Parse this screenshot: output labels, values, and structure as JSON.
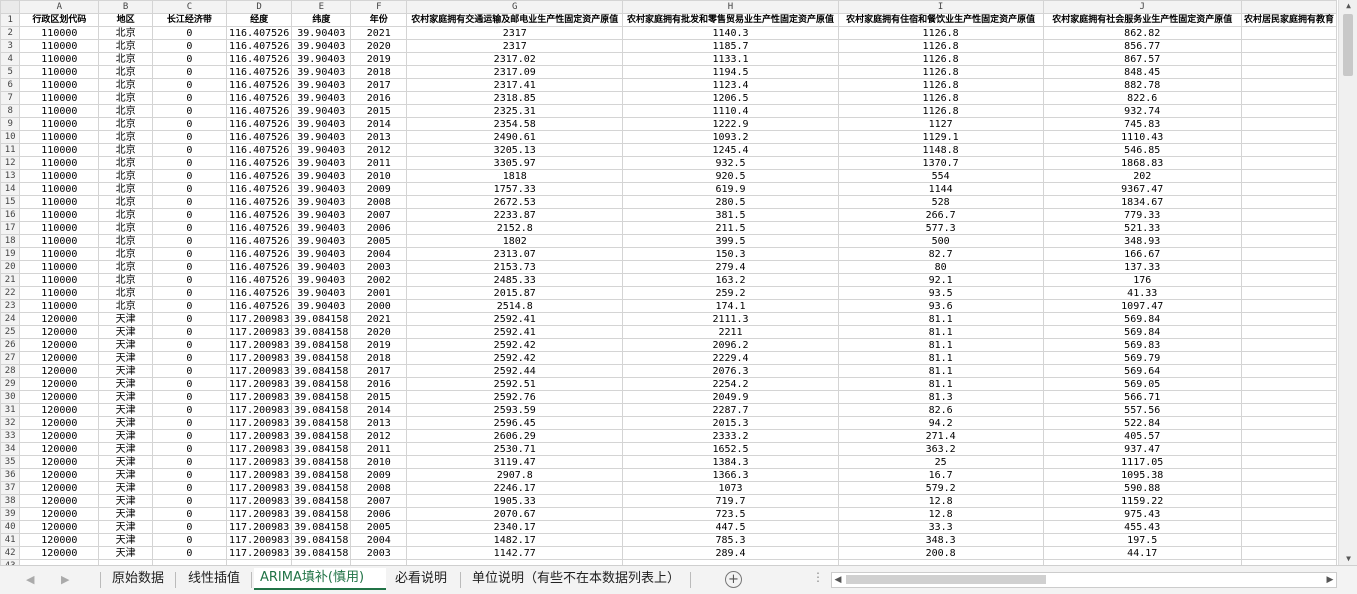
{
  "columns": [
    "A",
    "B",
    "C",
    "D",
    "E",
    "F",
    "G",
    "H",
    "I",
    "J"
  ],
  "headers": [
    "行政区划代码",
    "地区",
    "长江经济带",
    "经度",
    "纬度",
    "年份",
    "农村家庭拥有交通运输及邮电业生产性固定资产原值",
    "农村家庭拥有批发和零售贸易业生产性固定资产原值",
    "农村家庭拥有住宿和餐饮业生产性固定资产原值",
    "农村家庭拥有社会服务业生产性固定资产原值",
    "农村居民家庭拥有教育"
  ],
  "rows": [
    [
      "110000",
      "北京",
      "0",
      "116.407526",
      "39.90403",
      "2021",
      "2317",
      "1140.3",
      "1126.8",
      "862.82"
    ],
    [
      "110000",
      "北京",
      "0",
      "116.407526",
      "39.90403",
      "2020",
      "2317",
      "1185.7",
      "1126.8",
      "856.77"
    ],
    [
      "110000",
      "北京",
      "0",
      "116.407526",
      "39.90403",
      "2019",
      "2317.02",
      "1133.1",
      "1126.8",
      "867.57"
    ],
    [
      "110000",
      "北京",
      "0",
      "116.407526",
      "39.90403",
      "2018",
      "2317.09",
      "1194.5",
      "1126.8",
      "848.45"
    ],
    [
      "110000",
      "北京",
      "0",
      "116.407526",
      "39.90403",
      "2017",
      "2317.41",
      "1123.4",
      "1126.8",
      "882.78"
    ],
    [
      "110000",
      "北京",
      "0",
      "116.407526",
      "39.90403",
      "2016",
      "2318.85",
      "1206.5",
      "1126.8",
      "822.6"
    ],
    [
      "110000",
      "北京",
      "0",
      "116.407526",
      "39.90403",
      "2015",
      "2325.31",
      "1110.4",
      "1126.8",
      "932.74"
    ],
    [
      "110000",
      "北京",
      "0",
      "116.407526",
      "39.90403",
      "2014",
      "2354.58",
      "1222.9",
      "1127",
      "745.83"
    ],
    [
      "110000",
      "北京",
      "0",
      "116.407526",
      "39.90403",
      "2013",
      "2490.61",
      "1093.2",
      "1129.1",
      "1110.43"
    ],
    [
      "110000",
      "北京",
      "0",
      "116.407526",
      "39.90403",
      "2012",
      "3205.13",
      "1245.4",
      "1148.8",
      "546.85"
    ],
    [
      "110000",
      "北京",
      "0",
      "116.407526",
      "39.90403",
      "2011",
      "3305.97",
      "932.5",
      "1370.7",
      "1868.83"
    ],
    [
      "110000",
      "北京",
      "0",
      "116.407526",
      "39.90403",
      "2010",
      "1818",
      "920.5",
      "554",
      "202"
    ],
    [
      "110000",
      "北京",
      "0",
      "116.407526",
      "39.90403",
      "2009",
      "1757.33",
      "619.9",
      "1144",
      "9367.47"
    ],
    [
      "110000",
      "北京",
      "0",
      "116.407526",
      "39.90403",
      "2008",
      "2672.53",
      "280.5",
      "528",
      "1834.67"
    ],
    [
      "110000",
      "北京",
      "0",
      "116.407526",
      "39.90403",
      "2007",
      "2233.87",
      "381.5",
      "266.7",
      "779.33"
    ],
    [
      "110000",
      "北京",
      "0",
      "116.407526",
      "39.90403",
      "2006",
      "2152.8",
      "211.5",
      "577.3",
      "521.33"
    ],
    [
      "110000",
      "北京",
      "0",
      "116.407526",
      "39.90403",
      "2005",
      "1802",
      "399.5",
      "500",
      "348.93"
    ],
    [
      "110000",
      "北京",
      "0",
      "116.407526",
      "39.90403",
      "2004",
      "2313.07",
      "150.3",
      "82.7",
      "166.67"
    ],
    [
      "110000",
      "北京",
      "0",
      "116.407526",
      "39.90403",
      "2003",
      "2153.73",
      "279.4",
      "80",
      "137.33"
    ],
    [
      "110000",
      "北京",
      "0",
      "116.407526",
      "39.90403",
      "2002",
      "2485.33",
      "163.2",
      "92.1",
      "176"
    ],
    [
      "110000",
      "北京",
      "0",
      "116.407526",
      "39.90403",
      "2001",
      "2015.87",
      "259.2",
      "93.5",
      "41.33"
    ],
    [
      "110000",
      "北京",
      "0",
      "116.407526",
      "39.90403",
      "2000",
      "2514.8",
      "174.1",
      "93.6",
      "1097.47"
    ],
    [
      "120000",
      "天津",
      "0",
      "117.200983",
      "39.084158",
      "2021",
      "2592.41",
      "2111.3",
      "81.1",
      "569.84"
    ],
    [
      "120000",
      "天津",
      "0",
      "117.200983",
      "39.084158",
      "2020",
      "2592.41",
      "2211",
      "81.1",
      "569.84"
    ],
    [
      "120000",
      "天津",
      "0",
      "117.200983",
      "39.084158",
      "2019",
      "2592.42",
      "2096.2",
      "81.1",
      "569.83"
    ],
    [
      "120000",
      "天津",
      "0",
      "117.200983",
      "39.084158",
      "2018",
      "2592.42",
      "2229.4",
      "81.1",
      "569.79"
    ],
    [
      "120000",
      "天津",
      "0",
      "117.200983",
      "39.084158",
      "2017",
      "2592.44",
      "2076.3",
      "81.1",
      "569.64"
    ],
    [
      "120000",
      "天津",
      "0",
      "117.200983",
      "39.084158",
      "2016",
      "2592.51",
      "2254.2",
      "81.1",
      "569.05"
    ],
    [
      "120000",
      "天津",
      "0",
      "117.200983",
      "39.084158",
      "2015",
      "2592.76",
      "2049.9",
      "81.3",
      "566.71"
    ],
    [
      "120000",
      "天津",
      "0",
      "117.200983",
      "39.084158",
      "2014",
      "2593.59",
      "2287.7",
      "82.6",
      "557.56"
    ],
    [
      "120000",
      "天津",
      "0",
      "117.200983",
      "39.084158",
      "2013",
      "2596.45",
      "2015.3",
      "94.2",
      "522.84"
    ],
    [
      "120000",
      "天津",
      "0",
      "117.200983",
      "39.084158",
      "2012",
      "2606.29",
      "2333.2",
      "271.4",
      "405.57"
    ],
    [
      "120000",
      "天津",
      "0",
      "117.200983",
      "39.084158",
      "2011",
      "2530.71",
      "1652.5",
      "363.2",
      "937.47"
    ],
    [
      "120000",
      "天津",
      "0",
      "117.200983",
      "39.084158",
      "2010",
      "3119.47",
      "1384.3",
      "25",
      "1117.05"
    ],
    [
      "120000",
      "天津",
      "0",
      "117.200983",
      "39.084158",
      "2009",
      "2907.8",
      "1366.3",
      "16.7",
      "1095.38"
    ],
    [
      "120000",
      "天津",
      "0",
      "117.200983",
      "39.084158",
      "2008",
      "2246.17",
      "1073",
      "579.2",
      "590.88"
    ],
    [
      "120000",
      "天津",
      "0",
      "117.200983",
      "39.084158",
      "2007",
      "1905.33",
      "719.7",
      "12.8",
      "1159.22"
    ],
    [
      "120000",
      "天津",
      "0",
      "117.200983",
      "39.084158",
      "2006",
      "2070.67",
      "723.5",
      "12.8",
      "975.43"
    ],
    [
      "120000",
      "天津",
      "0",
      "117.200983",
      "39.084158",
      "2005",
      "2340.17",
      "447.5",
      "33.3",
      "455.43"
    ],
    [
      "120000",
      "天津",
      "0",
      "117.200983",
      "39.084158",
      "2004",
      "1482.17",
      "785.3",
      "348.3",
      "197.5"
    ],
    [
      "120000",
      "天津",
      "0",
      "117.200983",
      "39.084158",
      "2003",
      "1142.77",
      "289.4",
      "200.8",
      "44.17"
    ]
  ],
  "tabs": [
    "原始数据",
    "线性插值",
    "ARIMA填补(慎用)",
    "必看说明",
    "单位说明（有些不在本数据列表上）"
  ],
  "active_tab_index": 2,
  "nav": {
    "prev": "◀",
    "next": "▶",
    "add": "+",
    "more": "⋮"
  },
  "colors": {
    "accent": "#217346"
  }
}
